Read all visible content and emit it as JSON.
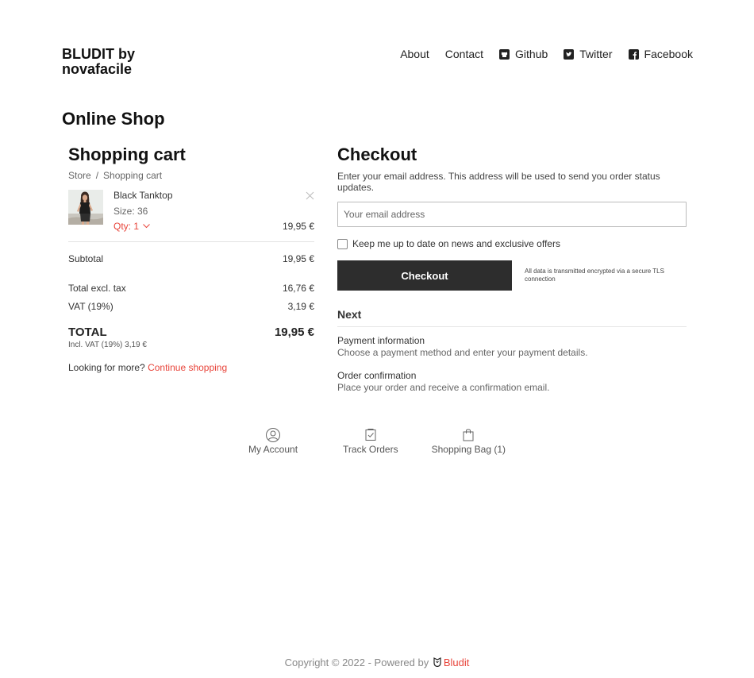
{
  "site": {
    "brand_line1": "BLUDIT by",
    "brand_line2": "novafacile"
  },
  "nav": [
    {
      "label": "About",
      "icon": null
    },
    {
      "label": "Contact",
      "icon": null
    },
    {
      "label": "Github",
      "icon": "github-icon"
    },
    {
      "label": "Twitter",
      "icon": "twitter-icon"
    },
    {
      "label": "Facebook",
      "icon": "facebook-icon"
    }
  ],
  "page_title": "Online Shop",
  "cart": {
    "title": "Shopping cart",
    "breadcrumb": [
      "Store",
      "Shopping cart"
    ],
    "breadcrumb_sep": "/",
    "item": {
      "name": "Black Tanktop",
      "size": "Size: 36",
      "qty": "Qty: 1",
      "price": "19,95 €"
    },
    "subtotal_label": "Subtotal",
    "subtotal_value": "19,95 €",
    "tax_label": "Total excl. tax",
    "tax_value": "16,76 €",
    "vat_label": "VAT (19%)",
    "vat_value": "3,19 €",
    "total_label": "TOTAL",
    "total_value": "19,95 €",
    "incl_note": "Incl. VAT (19%) 3,19 €",
    "more_text": "Looking for more?",
    "more_link": "Continue shopping"
  },
  "checkout": {
    "title": "Checkout",
    "intro": "Enter your email address. This address will be used to send you order status updates.",
    "email_placeholder": "Your email address",
    "newsletter_label": "Keep me up to date on news and exclusive offers",
    "button_label": "Checkout",
    "secure_note": "All data is transmitted encrypted via a secure TLS connection",
    "next_title": "Next",
    "steps": [
      {
        "title": "Payment information",
        "desc": "Choose a payment method and enter your payment details."
      },
      {
        "title": "Order confirmation",
        "desc": "Place your order and receive a confirmation email."
      }
    ]
  },
  "bottom_nav": [
    {
      "label": "My Account",
      "icon": "user-icon"
    },
    {
      "label": "Track Orders",
      "icon": "clipboard-check-icon"
    },
    {
      "label": "Shopping Bag (1)",
      "icon": "bag-icon"
    }
  ],
  "footer": {
    "text": "Copyright © 2022 - Powered by",
    "link": "Bludit"
  },
  "colors": {
    "accent": "#e8443a",
    "button_bg": "#2d2d2d"
  }
}
